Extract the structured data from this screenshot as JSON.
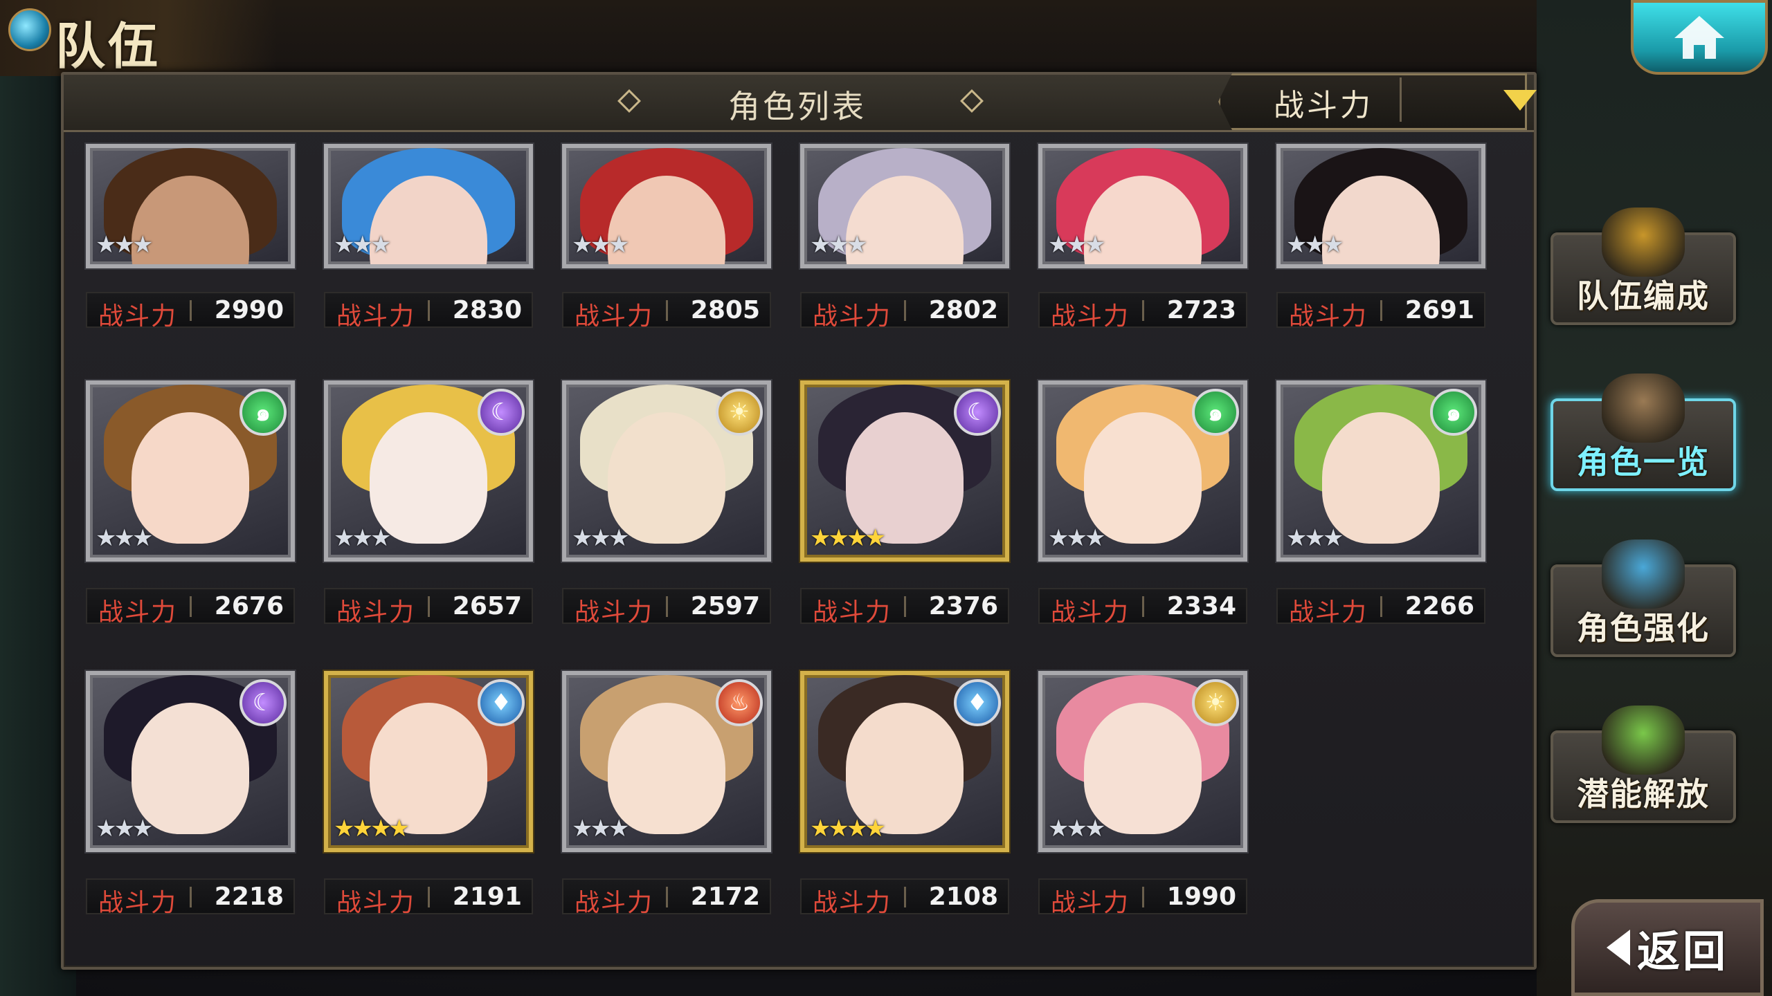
{
  "header": {
    "page_title": "队伍",
    "list_title": "角色列表",
    "sort": {
      "label": "战斗力",
      "icon": "dropdown-triangle-icon"
    },
    "home_icon": "home-icon"
  },
  "power_label": "战斗力",
  "cards": [
    {
      "power": "2990",
      "stars": "★★★",
      "rarity": "silver",
      "element": "none",
      "hair": "#4a2c18",
      "face": "#c89878"
    },
    {
      "power": "2830",
      "stars": "★★★",
      "rarity": "silver",
      "element": "none",
      "hair": "#3a8ad8",
      "face": "#f2d4c8"
    },
    {
      "power": "2805",
      "stars": "★★★",
      "rarity": "silver",
      "element": "none",
      "hair": "#b82a2a",
      "face": "#f0c8b4"
    },
    {
      "power": "2802",
      "stars": "★★★",
      "rarity": "silver",
      "element": "none",
      "hair": "#b8b0c8",
      "face": "#f4dcd0"
    },
    {
      "power": "2723",
      "stars": "★★★",
      "rarity": "silver",
      "element": "none",
      "hair": "#d83a5a",
      "face": "#f6d8cc"
    },
    {
      "power": "2691",
      "stars": "★★★",
      "rarity": "silver",
      "element": "none",
      "hair": "#1a1416",
      "face": "#f2d8cc"
    },
    {
      "power": "2676",
      "stars": "★★★",
      "rarity": "silver",
      "element": "green",
      "hair": "#8a5a2a",
      "face": "#f6d8c8"
    },
    {
      "power": "2657",
      "stars": "★★★",
      "rarity": "silver",
      "element": "purple",
      "hair": "#e8c048",
      "face": "#f6eae4"
    },
    {
      "power": "2597",
      "stars": "★★★",
      "rarity": "silver",
      "element": "sun",
      "hair": "#e8e0c8",
      "face": "#f2e0cc"
    },
    {
      "power": "2376",
      "stars": "★★★★",
      "rarity": "gold",
      "element": "purple",
      "hair": "#2a2434",
      "face": "#e8d0d0"
    },
    {
      "power": "2334",
      "stars": "★★★",
      "rarity": "silver",
      "element": "green",
      "hair": "#f0b870",
      "face": "#f8e0d0"
    },
    {
      "power": "2266",
      "stars": "★★★",
      "rarity": "silver",
      "element": "green",
      "hair": "#8ab848",
      "face": "#f4dccc"
    },
    {
      "power": "2218",
      "stars": "★★★",
      "rarity": "silver",
      "element": "purple",
      "hair": "#1e1a2a",
      "face": "#f4e0d4"
    },
    {
      "power": "2191",
      "stars": "★★★★",
      "rarity": "gold",
      "element": "water",
      "hair": "#b85a3a",
      "face": "#f6dccc"
    },
    {
      "power": "2172",
      "stars": "★★★",
      "rarity": "silver",
      "element": "fire",
      "hair": "#c8a070",
      "face": "#f6e0d0"
    },
    {
      "power": "2108",
      "stars": "★★★★",
      "rarity": "gold",
      "element": "water",
      "hair": "#3a2a24",
      "face": "#f4dccc"
    },
    {
      "power": "1990",
      "stars": "★★★",
      "rarity": "silver",
      "element": "sun",
      "hair": "#e88aa0",
      "face": "#f6e0d4"
    }
  ],
  "side_menu": [
    {
      "label": "队伍编成",
      "icon": "team-characters-icon",
      "active": false
    },
    {
      "label": "角色一览",
      "icon": "open-book-icon",
      "active": true
    },
    {
      "label": "角色强化",
      "icon": "enhance-crystal-icon",
      "active": false
    },
    {
      "label": "潜能解放",
      "icon": "potential-orb-icon",
      "active": false
    }
  ],
  "back": {
    "label": "返回",
    "icon": "back-arrow-icon"
  },
  "colors": {
    "power_label": "#e04a3a",
    "sort_arrow": "#f2d24a",
    "active_border": "#6fd6e8",
    "gold_frame": "#d4b24a"
  }
}
